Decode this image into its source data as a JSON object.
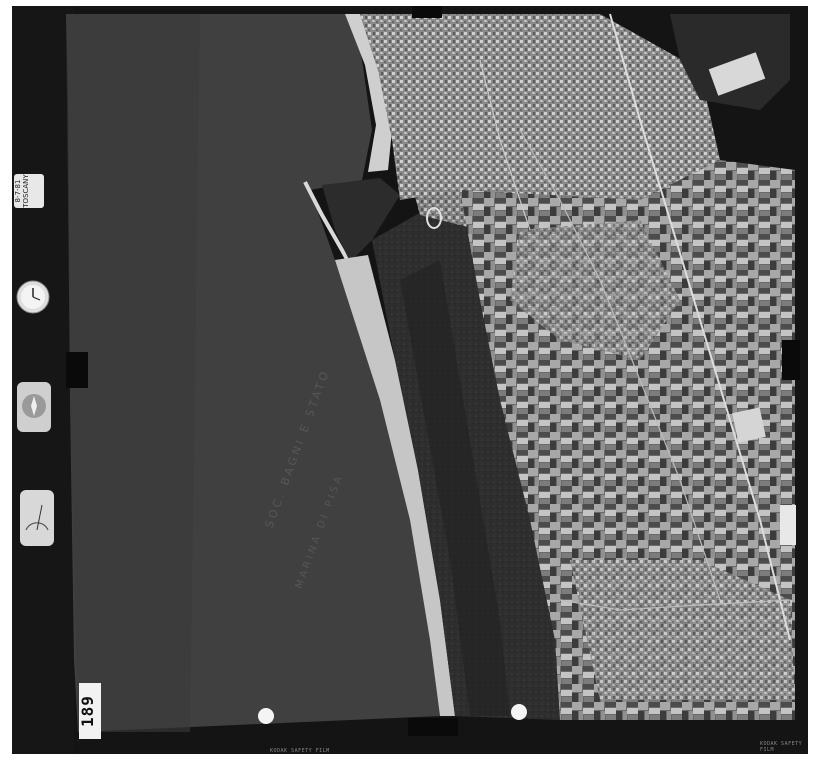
{
  "photo": {
    "frame_label": "8-7-81 TOSCANY",
    "frame_number": "189",
    "film_edge_left": "KODAK SAFETY FILM",
    "film_edge_right": "KODAK SAFETY FILM",
    "ground_stencil": "SOC. BAGNI E STATO",
    "ground_stencil_2": "MARINA DI PISA"
  },
  "instruments": {
    "clock": "clock-icon",
    "compass": "compass-icon",
    "level": "level-gauge-icon"
  },
  "colors": {
    "film_border": "#141414",
    "sea": "#3f3f3f",
    "beach": "#c9c9c9",
    "pine_forest": "#2a2a2a",
    "city": "#9a9a9a",
    "fields_light": "#b5b5b5",
    "fields_dark": "#4a4a4a"
  }
}
